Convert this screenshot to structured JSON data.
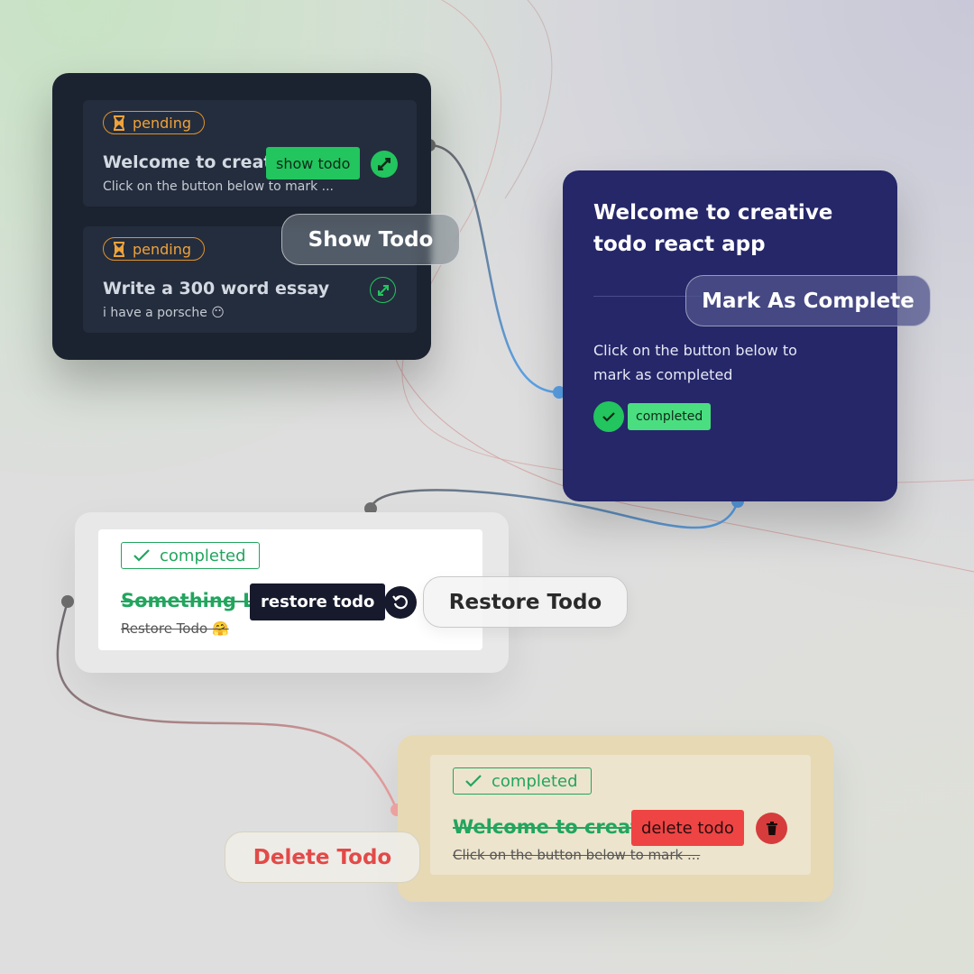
{
  "pending_panel": {
    "items": [
      {
        "status": "pending",
        "title": "Welcome to creativ",
        "description": "Click on the button below to mark ..."
      },
      {
        "status": "pending",
        "title": "Write a 300 word essay",
        "description": "i have a porsche 😶"
      }
    ],
    "tooltip": "show todo",
    "action_label": "Show Todo"
  },
  "detail_panel": {
    "title": "Welcome to creative todo react app",
    "description": "Click on the button below to mark as completed",
    "status": "completed",
    "action_label": "Mark As Complete"
  },
  "restore_panel": {
    "status": "completed",
    "title": "Something L",
    "description": "Restore Todo 🤗",
    "tooltip": "restore todo",
    "action_label": "Restore Todo"
  },
  "delete_panel": {
    "status": "completed",
    "title": "Welcome to creati",
    "description": "Click on the button below to mark ...",
    "tooltip": "delete todo",
    "action_label": "Delete Todo"
  },
  "colors": {
    "dark_panel": "#1c2330",
    "navy_panel": "#252769",
    "success_green": "#22c55e",
    "pending_orange": "#e0922a",
    "danger_red": "#ef4444",
    "tan_panel": "#e6d9b4"
  }
}
